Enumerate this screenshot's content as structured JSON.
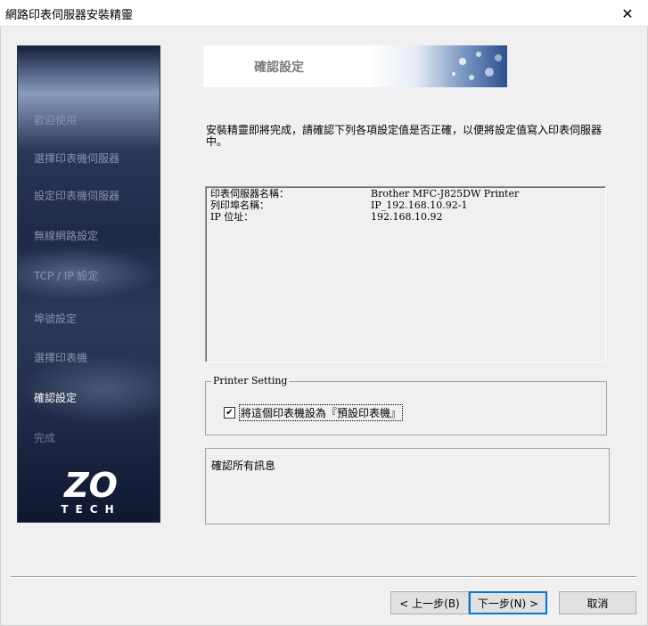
{
  "window": {
    "title": "網路印表伺服器安裝精靈",
    "close_glyph": "✕"
  },
  "sidebar": {
    "steps": [
      {
        "label": "歡迎使用",
        "state": "done"
      },
      {
        "label": "選擇印表機伺服器",
        "state": "done"
      },
      {
        "label": "設定印表機伺服器",
        "state": "done"
      },
      {
        "label": "無線網路設定",
        "state": "done"
      },
      {
        "label": "TCP / IP 設定",
        "state": "done"
      },
      {
        "label": "埠號設定",
        "state": "done"
      },
      {
        "label": "選擇印表機",
        "state": "done"
      },
      {
        "label": "確認設定",
        "state": "current"
      },
      {
        "label": "完成",
        "state": "pending"
      }
    ],
    "logo": {
      "main": "ZO",
      "sub": "TECH"
    }
  },
  "header": {
    "title": "確認設定"
  },
  "description": "安裝精靈即將完成，請確認下列各項設定值是否正確，以便將設定值寫入印表伺服器中。",
  "summary": {
    "rows": [
      {
        "label": "印表伺服器名稱：",
        "value": "Brother MFC-J825DW Printer"
      },
      {
        "label": "列印埠名稱：",
        "value": "IP_192.168.10.92-1"
      },
      {
        "label": "IP 位址：",
        "value": "192.168.10.92"
      }
    ]
  },
  "printer_setting": {
    "legend": "Printer Setting",
    "checkbox_label": "將這個印表機設為『預設印表機』",
    "checked": true,
    "check_glyph": "✔"
  },
  "message": "確認所有訊息",
  "buttons": {
    "back": "< 上一步(B)",
    "next": "下一步(N) >",
    "cancel": "取消"
  }
}
